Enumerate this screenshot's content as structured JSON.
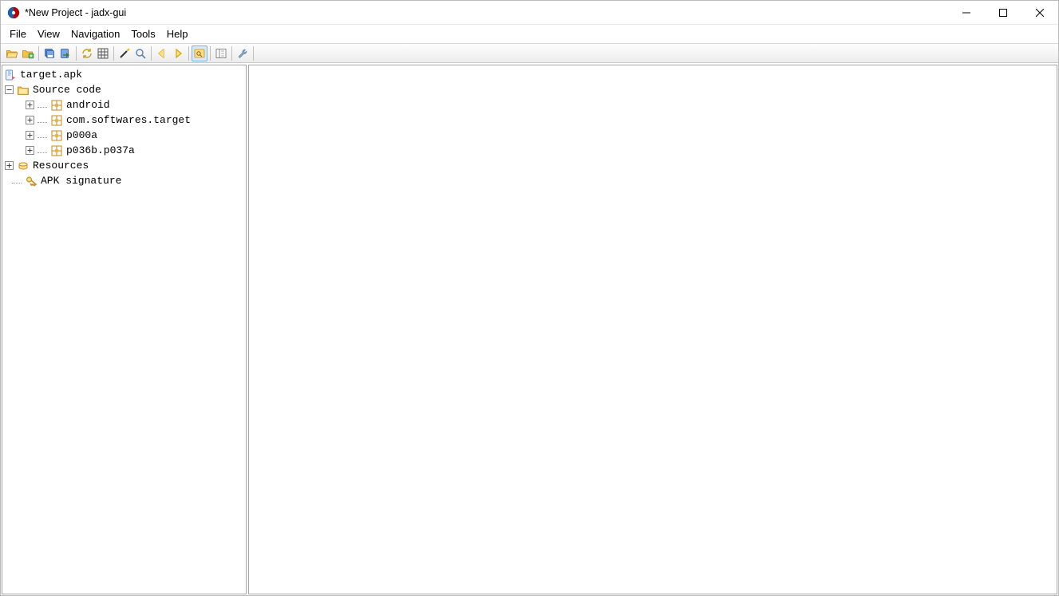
{
  "window": {
    "title": "*New Project - jadx-gui"
  },
  "menubar": {
    "items": [
      "File",
      "View",
      "Navigation",
      "Tools",
      "Help"
    ]
  },
  "toolbar": {
    "buttons": [
      {
        "name": "open-folder",
        "sep_after": false
      },
      {
        "name": "add-files",
        "sep_after": true
      },
      {
        "name": "save-all",
        "sep_after": false
      },
      {
        "name": "export",
        "sep_after": true
      },
      {
        "name": "refresh",
        "sep_after": false
      },
      {
        "name": "flatten-packages",
        "sep_after": true
      },
      {
        "name": "deobfuscate",
        "sep_after": false
      },
      {
        "name": "search",
        "sep_after": true
      },
      {
        "name": "back",
        "sep_after": false
      },
      {
        "name": "forward",
        "sep_after": true
      },
      {
        "name": "quick-search",
        "active": true,
        "sep_after": true
      },
      {
        "name": "show-hide",
        "sep_after": true
      },
      {
        "name": "preferences",
        "sep_after": true
      }
    ]
  },
  "tree": {
    "root": {
      "label": "target.apk",
      "icon": "apk",
      "children": [
        {
          "label": "Source code",
          "icon": "source",
          "expanded": true,
          "children": [
            {
              "label": "android",
              "icon": "package"
            },
            {
              "label": "com.softwares.target",
              "icon": "package"
            },
            {
              "label": "p000a",
              "icon": "package"
            },
            {
              "label": "p036b.p037a",
              "icon": "package"
            }
          ]
        },
        {
          "label": "Resources",
          "icon": "resources",
          "expandable": true
        },
        {
          "label": "APK signature",
          "icon": "key"
        }
      ]
    }
  }
}
